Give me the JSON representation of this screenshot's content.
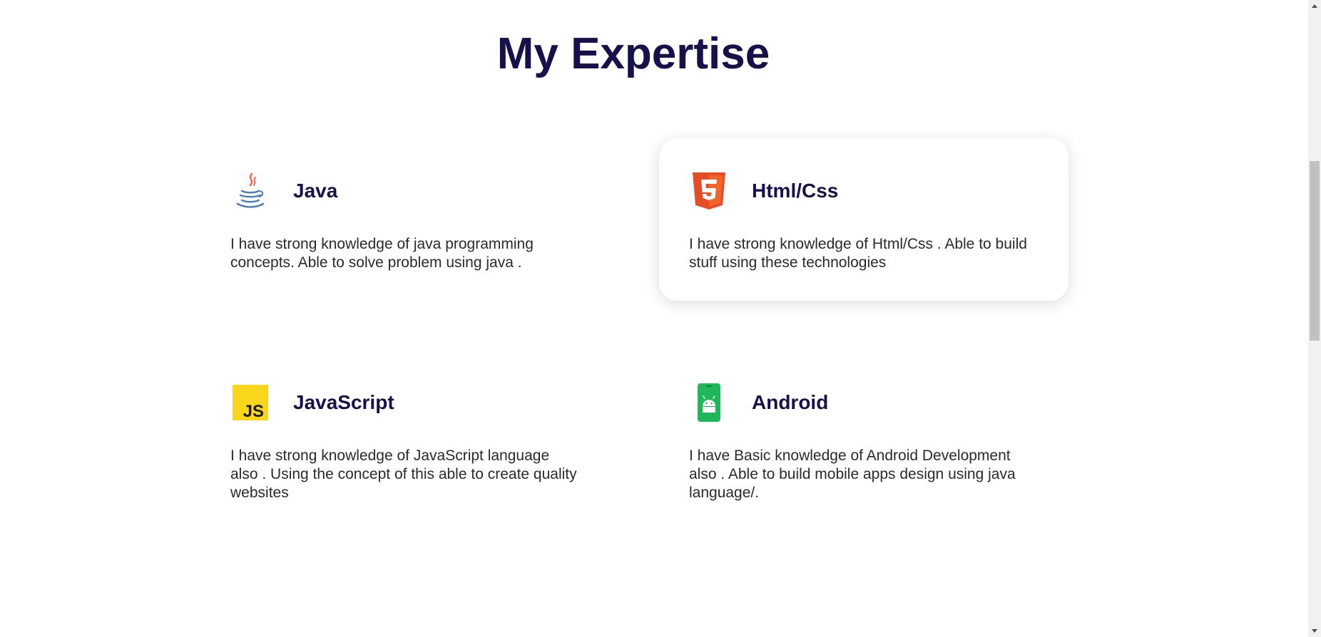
{
  "section": {
    "title": "My Expertise"
  },
  "cards": [
    {
      "title": "Java",
      "description": "I have strong knowledge of java programming concepts. Able to solve problem using java .",
      "icon": "java-icon",
      "highlighted": false
    },
    {
      "title": "Html/Css",
      "description": "I have strong knowledge of Html/Css . Able to build stuff using these technologies",
      "icon": "html5-icon",
      "highlighted": true
    },
    {
      "title": "JavaScript",
      "description": "I have strong knowledge of JavaScript language also . Using the concept of this able to create quality websites",
      "icon": "javascript-icon",
      "highlighted": false
    },
    {
      "title": "Android",
      "description": "I have Basic knowledge of Android Development also . Able to build mobile apps design using java language/.",
      "icon": "android-icon",
      "highlighted": false
    }
  ],
  "colors": {
    "heading": "#16114a",
    "text": "#2a2a2a",
    "html5_orange": "#e44d26",
    "js_yellow": "#f7d61c",
    "android_green": "#1fb75a",
    "java_red": "#e76f51",
    "java_blue": "#4e7fbd"
  }
}
